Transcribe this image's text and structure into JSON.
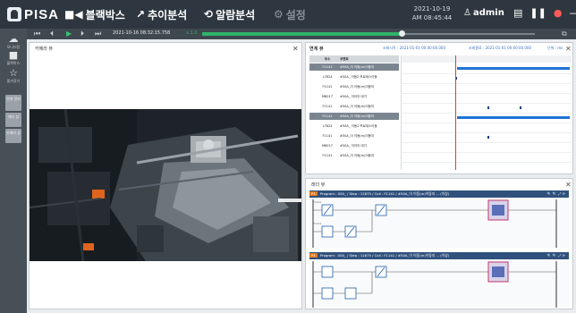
{
  "app": {
    "logo_text": "PISA",
    "accent_color": "#2fb36a",
    "nav": [
      {
        "label": "블랙박스",
        "icon": "video-camera-icon",
        "active": true
      },
      {
        "label": "추이분석",
        "icon": "trend-line-icon",
        "active": false
      },
      {
        "label": "알람분석",
        "icon": "clock-history-icon",
        "active": false
      },
      {
        "label": "설정",
        "icon": "gear-icon",
        "disabled": true
      }
    ],
    "date": "2021-10-19",
    "time": "AM 08:45:44",
    "user": "admin"
  },
  "sidebar": {
    "items": [
      {
        "label": "모니터링",
        "icon": "cloud-icon"
      },
      {
        "label": "블랙박스",
        "icon": "video-camera-icon"
      },
      {
        "label": "즐겨찾기",
        "icon": "star-settings-icon"
      }
    ],
    "tabs": [
      "연계 정보",
      "래더 뷰",
      "카메라 뷰"
    ]
  },
  "playback": {
    "timestamp": "2021-10-16 08:32:15.758",
    "speed": "x 1.0",
    "progress": 0.6
  },
  "camera_panel": {
    "title": "카메라 뷰"
  },
  "chart_panel": {
    "title": "연계 뷰",
    "start_label": "조회시작 : 2021-01-01 00:00:00.000",
    "end_label": "조회종료 : 2021-01-01 00:00:00.000",
    "unit_label": "단위 : ms",
    "columns": [
      "주소",
      "코멘트"
    ],
    "rows": [
      {
        "addr": "F1141",
        "comment": "#50A_이 이동(m)이동지",
        "highlight": true
      },
      {
        "addr": "L7824",
        "comment": "#50A_ 이동2 프로세스이동",
        "highlight": false
      },
      {
        "addr": "F1141",
        "comment": "#50A_이 이동(m)이동지",
        "highlight": false
      },
      {
        "addr": "M8017",
        "comment": "#50A_ 이이이 대기",
        "highlight": false
      },
      {
        "addr": "F1141",
        "comment": "#50A_이 이동(m)이동지",
        "highlight": false
      },
      {
        "addr": "F1141",
        "comment": "#50A_이 이동(m)이동지",
        "highlight": true
      },
      {
        "addr": "L7824",
        "comment": "#50A_ 이동2 프로세스이동",
        "highlight": false
      },
      {
        "addr": "F1141",
        "comment": "#50A_이 이동(m)이동지",
        "highlight": false
      },
      {
        "addr": "M8017",
        "comment": "#50A_ 이이이 대기",
        "highlight": false
      },
      {
        "addr": "F1141",
        "comment": "#50A_이 이동(m)이동지",
        "highlight": false
      }
    ]
  },
  "ladder_panel": {
    "title": "래더 뷰",
    "rungs": [
      {
        "tag": "P4",
        "text": "Program : 000_ / Step : 11875 / Coil : F1141 / #50A_이 이동(m)이동지 ... (이상)"
      },
      {
        "tag": "P4",
        "text": "Program : 000_ / Step : 11875 / Coil : F1141 / #50A_이 이동(m)이동지 ... (이상)"
      }
    ]
  }
}
